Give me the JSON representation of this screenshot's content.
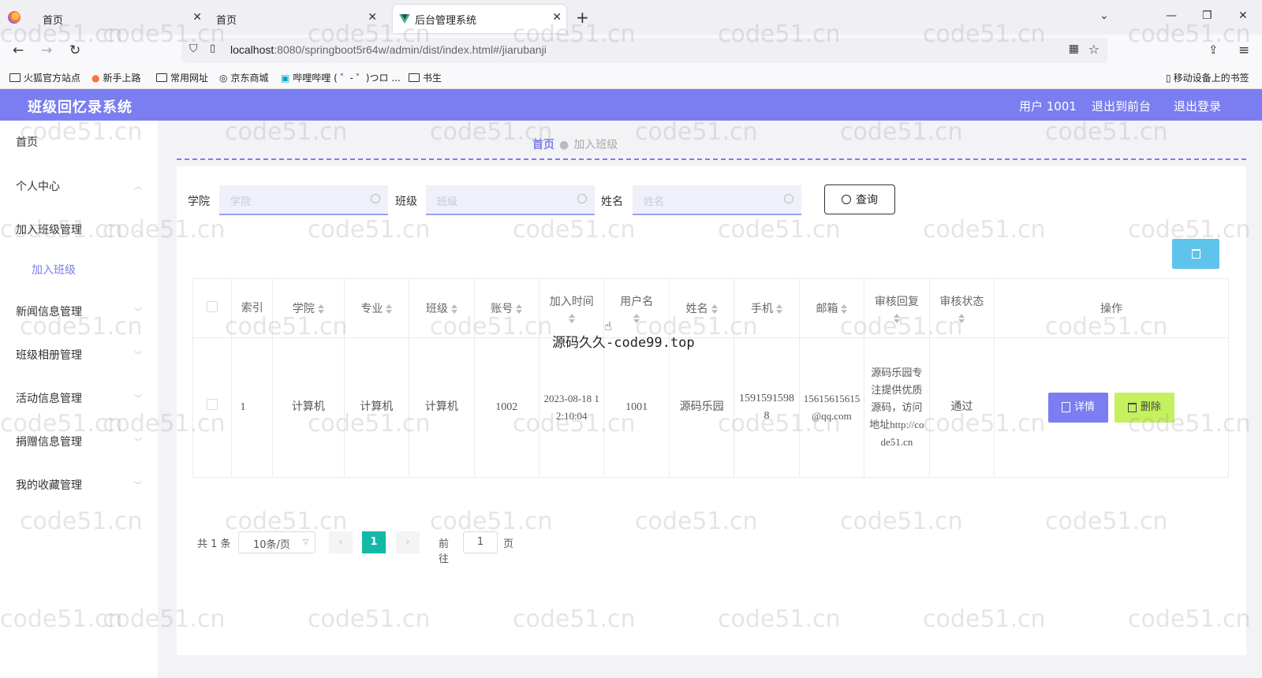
{
  "browser": {
    "tabs": [
      {
        "title": "首页"
      },
      {
        "title": "首页"
      },
      {
        "title": "后台管理系统"
      }
    ],
    "url_host": "localhost",
    "url_rest": ":8080/springboot5r64w/admin/dist/index.html#/jiarubanji",
    "bookmarks": [
      "火狐官方站点",
      "新手上路",
      "常用网址",
      "京东商城",
      "哔哩哔哩 ( ゜- ゜)つロ ...",
      "书生"
    ],
    "mobile_bookmarks": "移动设备上的书签"
  },
  "header": {
    "title": "班级回忆录系统",
    "user": "用户 1001",
    "to_front": "退出到前台",
    "logout": "退出登录"
  },
  "sidebar": {
    "items": [
      "首页",
      "个人中心",
      "加入班级管理",
      "加入班级",
      "新闻信息管理",
      "班级相册管理",
      "活动信息管理",
      "捐赠信息管理",
      "我的收藏管理"
    ]
  },
  "breadcrumb": {
    "home": "首页",
    "current": "加入班级"
  },
  "search": {
    "college_label": "学院",
    "college_placeholder": "学院",
    "class_label": "班级",
    "class_placeholder": "班级",
    "name_label": "姓名",
    "name_placeholder": "姓名",
    "query_label": "查询"
  },
  "table": {
    "headers": [
      "索引",
      "学院",
      "专业",
      "班级",
      "账号",
      "加入时间",
      "用户名",
      "姓名",
      "手机",
      "邮箱",
      "审核回复",
      "审核状态",
      "操作"
    ],
    "rows": [
      {
        "index": "1",
        "college": "计算机",
        "major": "计算机",
        "class": "计算机",
        "account": "1002",
        "join_time": "2023-08-18 12:10:04",
        "username": "1001",
        "name": "源码乐园",
        "phone": "15915915988",
        "email": "15615615615@qq.com",
        "reply": "源码乐园专注提供优质源码，访问地址http://code51.cn",
        "status": "通过",
        "detail_label": "详情",
        "delete_label": "删除"
      }
    ]
  },
  "pagination": {
    "total": "共 1 条",
    "page_size": "10条/页",
    "current_page": "1",
    "goto_prefix": "前往",
    "goto_value": "1",
    "goto_suffix": "页"
  },
  "overlay": "源码久久-code99.top",
  "watermark": "code51.cn",
  "colors": {
    "accent": "#7b7ef0",
    "pager_active": "#14b8a6",
    "delete": "#c4f15e",
    "top_delete": "#5fc4ec"
  }
}
